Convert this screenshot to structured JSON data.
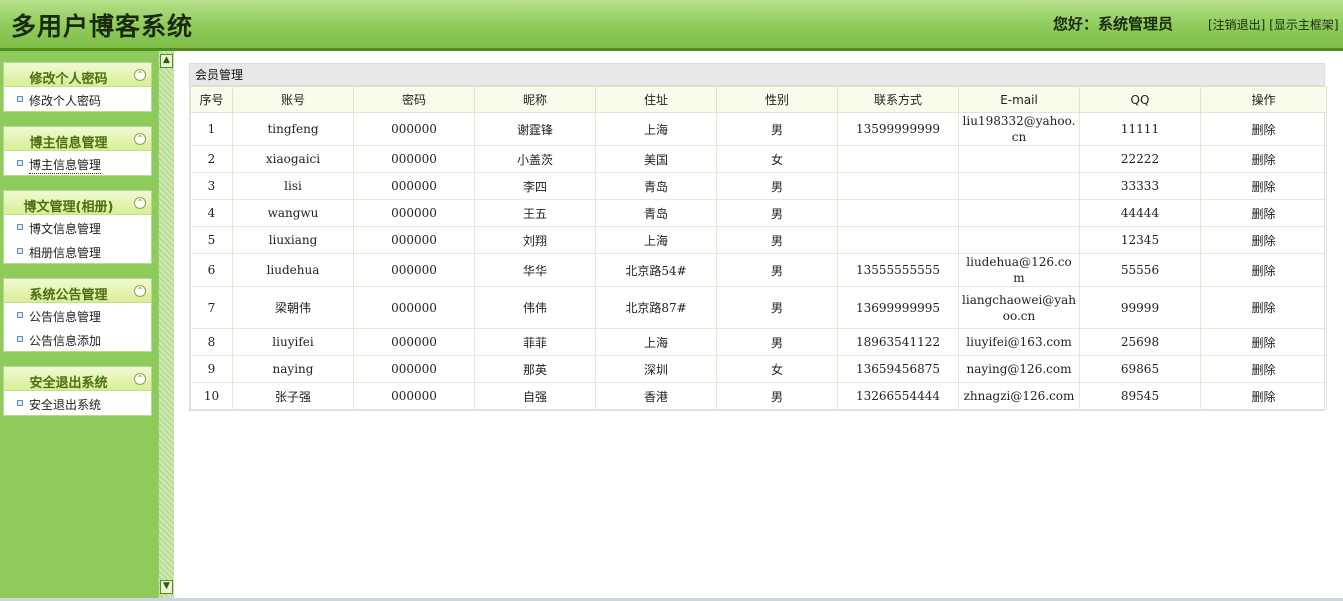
{
  "header": {
    "title": "多用户博客系统",
    "greeting": "您好：系统管理员",
    "logout_label": "[注销退出]",
    "show_frame_label": "[显示主框架]"
  },
  "sidebar": {
    "groups": [
      {
        "title": "修改个人密码",
        "items": [
          "修改个人密码"
        ]
      },
      {
        "title": "博主信息管理",
        "items": [
          "博主信息管理"
        ]
      },
      {
        "title": "博文管理(相册)",
        "items": [
          "博文信息管理",
          "相册信息管理"
        ]
      },
      {
        "title": "系统公告管理",
        "items": [
          "公告信息管理",
          "公告信息添加"
        ]
      },
      {
        "title": "安全退出系统",
        "items": [
          "安全退出系统"
        ]
      }
    ],
    "collapse_glyph": "⌃",
    "splitter_up_glyph": "▲",
    "splitter_down_glyph": "▼"
  },
  "main": {
    "panel_title": "会员管理",
    "columns": [
      "序号",
      "账号",
      "密码",
      "昵称",
      "住址",
      "性别",
      "联系方式",
      "E-mail",
      "QQ",
      "操作"
    ],
    "rows": [
      [
        "1",
        "tingfeng",
        "000000",
        "谢霆锋",
        "上海",
        "男",
        "13599999999",
        "liu198332@yahoo.cn",
        "11111",
        "删除"
      ],
      [
        "2",
        "xiaogaici",
        "000000",
        "小盖茨",
        "美国",
        "女",
        "",
        "",
        "22222",
        "删除"
      ],
      [
        "3",
        "lisi",
        "000000",
        "李四",
        "青岛",
        "男",
        "",
        "",
        "33333",
        "删除"
      ],
      [
        "4",
        "wangwu",
        "000000",
        "王五",
        "青岛",
        "男",
        "",
        "",
        "44444",
        "删除"
      ],
      [
        "5",
        "liuxiang",
        "000000",
        "刘翔",
        "上海",
        "男",
        "",
        "",
        "12345",
        "删除"
      ],
      [
        "6",
        "liudehua",
        "000000",
        "华华",
        "北京路54#",
        "男",
        "13555555555",
        "liudehua@126.com",
        "55556",
        "删除"
      ],
      [
        "7",
        "梁朝伟",
        "000000",
        "伟伟",
        "北京路87#",
        "男",
        "13699999995",
        "liangchaowei@yahoo.cn",
        "99999",
        "删除"
      ],
      [
        "8",
        "liuyifei",
        "000000",
        "菲菲",
        "上海",
        "男",
        "18963541122",
        "liuyifei@163.com",
        "25698",
        "删除"
      ],
      [
        "9",
        "naying",
        "000000",
        "那英",
        "深圳",
        "女",
        "13659456875",
        "naying@126.com",
        "69865",
        "删除"
      ],
      [
        "10",
        "张子强",
        "000000",
        "自强",
        "香港",
        "男",
        "13266554444",
        "zhnagzi@126.com",
        "89545",
        "删除"
      ]
    ]
  }
}
